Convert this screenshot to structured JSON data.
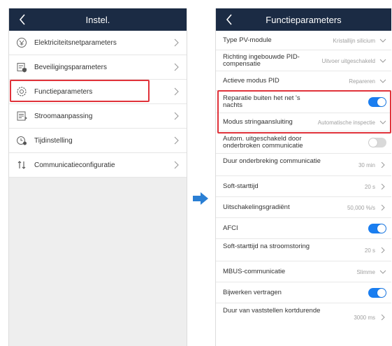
{
  "left_screen": {
    "header_title": "Instel.",
    "menu_items": [
      {
        "label": "Elektriciteitsnetparameters",
        "icon": "grid-parameters-icon"
      },
      {
        "label": "Beveiligingsparameters",
        "icon": "protection-parameters-icon"
      },
      {
        "label": "Functieparameters",
        "icon": "function-parameters-icon",
        "highlighted": true
      },
      {
        "label": "Stroomaanpassing",
        "icon": "power-adjustment-icon"
      },
      {
        "label": "Tijdinstelling",
        "icon": "time-setting-icon"
      },
      {
        "label": "Communicatieconfiguratie",
        "icon": "communication-config-icon"
      }
    ]
  },
  "right_screen": {
    "header_title": "Functieparameters",
    "params": [
      {
        "label": "Type PV-module",
        "value": "Kristallijn silicium",
        "control": "dropdown"
      },
      {
        "label": "Richting ingebouwde PID-compensatie",
        "value": "Uitvoer uitgeschakeld",
        "control": "dropdown"
      },
      {
        "label": "Actieve modus PID",
        "value": "Repareren",
        "control": "dropdown"
      },
      {
        "label": "Reparatie buiten het net 's nachts",
        "value": "",
        "control": "toggle",
        "on": true
      },
      {
        "label": "Modus stringaansluiting",
        "value": "Automatische inspectie",
        "control": "dropdown"
      },
      {
        "label": "Autom. uitgeschakeld door onderbroken communicatie",
        "value": "",
        "control": "toggle",
        "on": false
      },
      {
        "label": "Duur onderbreking communicatie",
        "value": "30 min",
        "control": "link"
      },
      {
        "label": "Soft-starttijd",
        "value": "20 s",
        "control": "link"
      },
      {
        "label": "Uitschakelingsgradiënt",
        "value": "50,000 %/s",
        "control": "link"
      },
      {
        "label": "AFCI",
        "value": "",
        "control": "toggle",
        "on": true
      },
      {
        "label": "Soft-starttijd na stroomstoring",
        "value": "20 s",
        "control": "link"
      },
      {
        "label": "MBUS-communicatie",
        "value": "Slimme",
        "control": "dropdown"
      },
      {
        "label": "Bijwerken vertragen",
        "value": "",
        "control": "toggle",
        "on": true
      },
      {
        "label": "Duur van vaststellen kortdurende",
        "value": "3000 ms",
        "control": "link"
      }
    ]
  },
  "colors": {
    "header_bg": "#1b2b44",
    "highlight_border": "#e0323a",
    "toggle_on": "#1a7ef0",
    "toggle_off": "#d9d9d9",
    "arrow": "#2a7fd4"
  },
  "icons": {
    "back": "chevron-left-icon",
    "row_chevron": "chevron-right-icon",
    "dropdown": "chevron-down-icon",
    "transition_arrow": "arrow-right-icon"
  }
}
